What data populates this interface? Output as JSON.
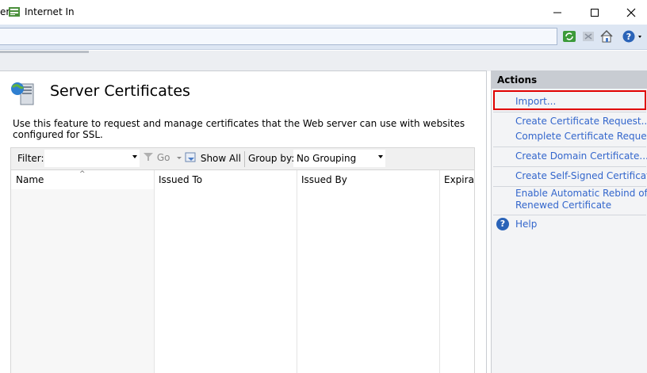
{
  "window": {
    "title_prefix": "er",
    "title": "Internet In",
    "minimize": "—",
    "maximize": "☐",
    "close": "✕"
  },
  "toolbar": {
    "icons": [
      "refresh-icon",
      "stop-icon",
      "home-icon",
      "help-icon"
    ]
  },
  "page": {
    "title": "Server Certificates",
    "description": "Use this feature to request and manage certificates that the Web server can use with websites configured for SSL."
  },
  "filterbar": {
    "filter_label": "Filter:",
    "go_label": "Go",
    "show_all_label": "Show All",
    "group_by_label": "Group by:",
    "group_by_value": "No Grouping"
  },
  "grid": {
    "columns": [
      "Name",
      "Issued To",
      "Issued By",
      "Expirati"
    ]
  },
  "actions": {
    "header": "Actions",
    "items": [
      "Import...",
      "Create Certificate Request...",
      "Complete Certificate Request...",
      "Create Domain Certificate...",
      "Create Self-Signed Certificate...",
      "Enable Automatic Rebind of",
      "Renewed Certificate",
      "Help"
    ]
  },
  "colors": {
    "link": "#3366cc",
    "highlight": "#e00000",
    "actions_header": "#c8ccd2"
  }
}
